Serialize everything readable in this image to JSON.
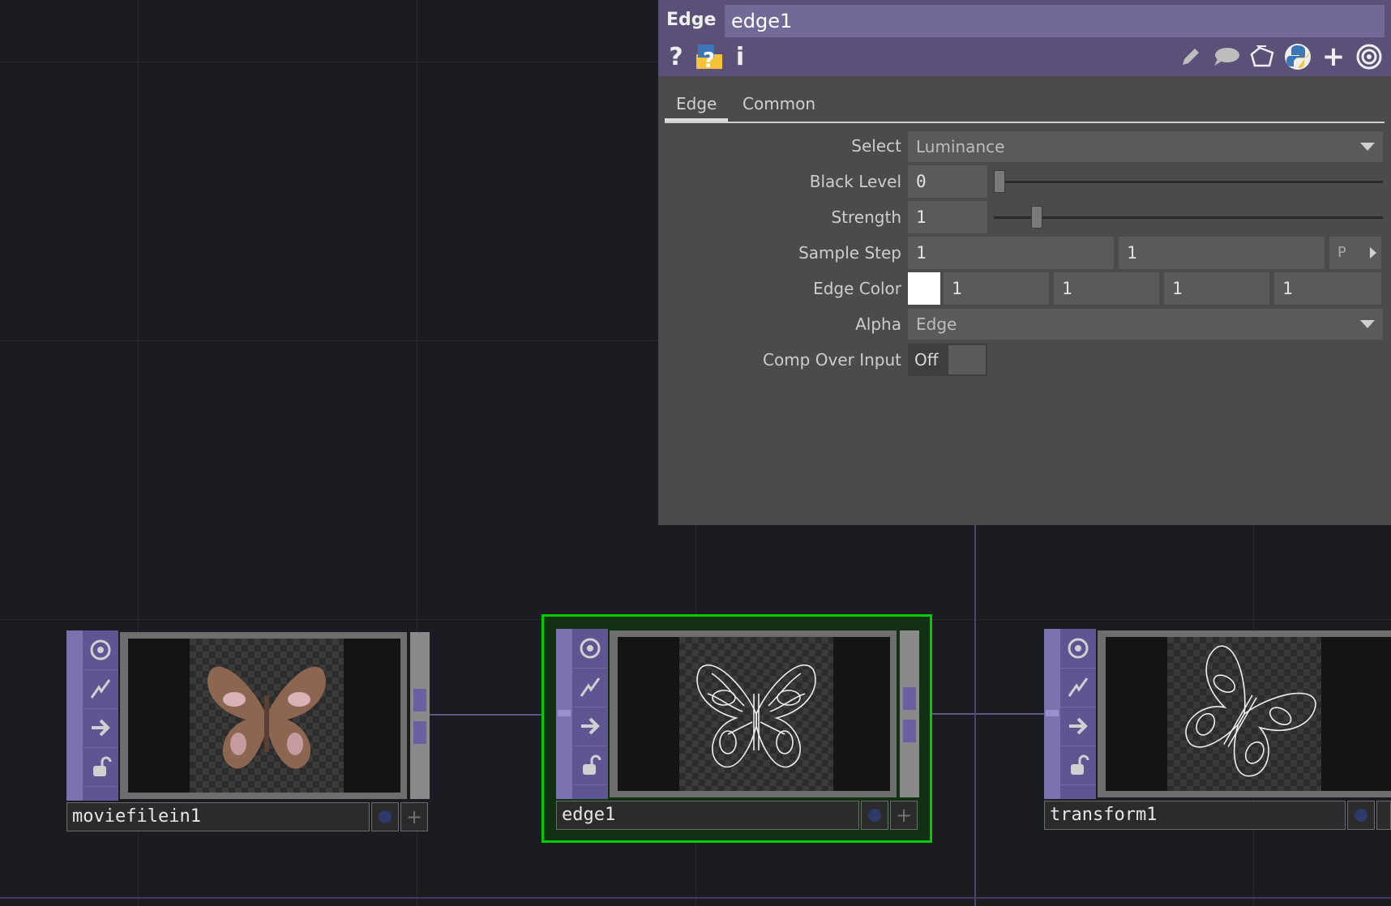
{
  "panel": {
    "op_type": "Edge",
    "op_name": "edge1",
    "header_icons": {
      "left": [
        "help-icon",
        "python-help-icon",
        "info-icon"
      ],
      "right": [
        "edit-icon",
        "comment-icon",
        "clone-icon",
        "python-icon",
        "add-icon",
        "target-icon"
      ]
    },
    "tabs": [
      "Edge",
      "Common"
    ],
    "params": {
      "select": {
        "label": "Select",
        "value": "Luminance"
      },
      "black_level": {
        "label": "Black Level",
        "value": "0",
        "slider": 0
      },
      "strength": {
        "label": "Strength",
        "value": "1",
        "slider": 0.1
      },
      "sample_step": {
        "label": "Sample Step",
        "values": [
          "1",
          "1"
        ],
        "button": "P"
      },
      "edge_color": {
        "label": "Edge Color",
        "swatch": "#ffffff",
        "values": [
          "1",
          "1",
          "1",
          "1"
        ]
      },
      "alpha": {
        "label": "Alpha",
        "value": "Edge"
      },
      "comp_over_input": {
        "label": "Comp Over Input",
        "value": "Off"
      }
    }
  },
  "nodes": [
    {
      "name": "moviefilein1",
      "selected": false
    },
    {
      "name": "edge1",
      "selected": true
    },
    {
      "name": "transform1",
      "selected": false
    }
  ],
  "colors": {
    "header": "#5a5078",
    "selection": "#00cc00",
    "node_accent": "#7c72ad",
    "wire": "#5d5789"
  }
}
